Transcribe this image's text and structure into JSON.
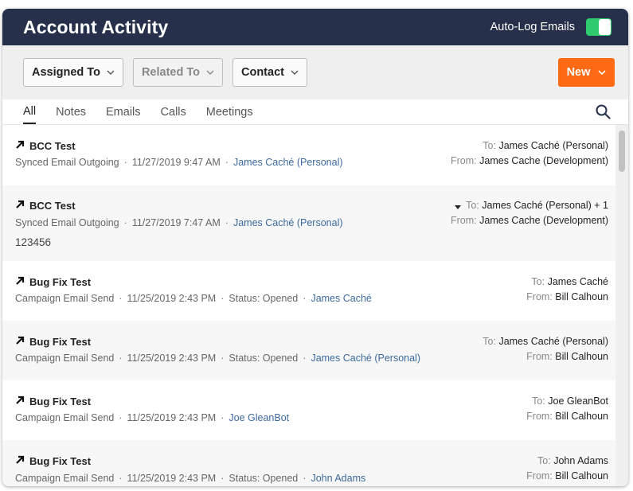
{
  "header": {
    "title": "Account Activity",
    "autolog_label": "Auto-Log Emails"
  },
  "filters": {
    "assigned": "Assigned To",
    "related": "Related To",
    "contact": "Contact",
    "new_label": "New"
  },
  "tabs": [
    {
      "label": "All",
      "active": true
    },
    {
      "label": "Notes"
    },
    {
      "label": "Emails"
    },
    {
      "label": "Calls"
    },
    {
      "label": "Meetings"
    }
  ],
  "activities": [
    {
      "subject": "BCC Test",
      "type": "Synced Email Outgoing",
      "datetime": "11/27/2019 9:47 AM",
      "status": "",
      "link": "James Caché (Personal)",
      "to_label": "To:",
      "to": "James Caché (Personal)",
      "from_label": "From:",
      "from": "James Cache (Development)"
    },
    {
      "subject": "BCC Test",
      "type": "Synced Email Outgoing",
      "datetime": "11/27/2019 7:47 AM",
      "status": "",
      "link": "James Caché (Personal)",
      "to_label": "To:",
      "to": "James Caché (Personal) + 1",
      "from_label": "From:",
      "from": "James Cache (Development)",
      "body": "123456"
    },
    {
      "subject": "Bug Fix Test",
      "type": "Campaign Email Send",
      "datetime": "11/25/2019 2:43 PM",
      "status": "Status: Opened",
      "link": "James Caché",
      "to_label": "To:",
      "to": "James Caché",
      "from_label": "From:",
      "from": "Bill Calhoun"
    },
    {
      "subject": "Bug Fix Test",
      "type": "Campaign Email Send",
      "datetime": "11/25/2019 2:43 PM",
      "status": "Status: Opened",
      "link": "James Caché (Personal)",
      "to_label": "To:",
      "to": "James Caché (Personal)",
      "from_label": "From:",
      "from": "Bill Calhoun"
    },
    {
      "subject": "Bug Fix Test",
      "type": "Campaign Email Send",
      "datetime": "11/25/2019 2:43 PM",
      "status": "",
      "link": "Joe GleanBot",
      "to_label": "To:",
      "to": "Joe GleanBot",
      "from_label": "From:",
      "from": "Bill Calhoun"
    },
    {
      "subject": "Bug Fix Test",
      "type": "Campaign Email Send",
      "datetime": "11/25/2019 2:43 PM",
      "status": "Status: Opened",
      "link": "John Adams",
      "to_label": "To:",
      "to": "John Adams",
      "from_label": "From:",
      "from": "Bill Calhoun"
    }
  ],
  "colors": {
    "header_bg": "#26304a",
    "toggle_on": "#2fca6d",
    "new_button": "#ff6a14",
    "link": "#3d6a9e"
  }
}
